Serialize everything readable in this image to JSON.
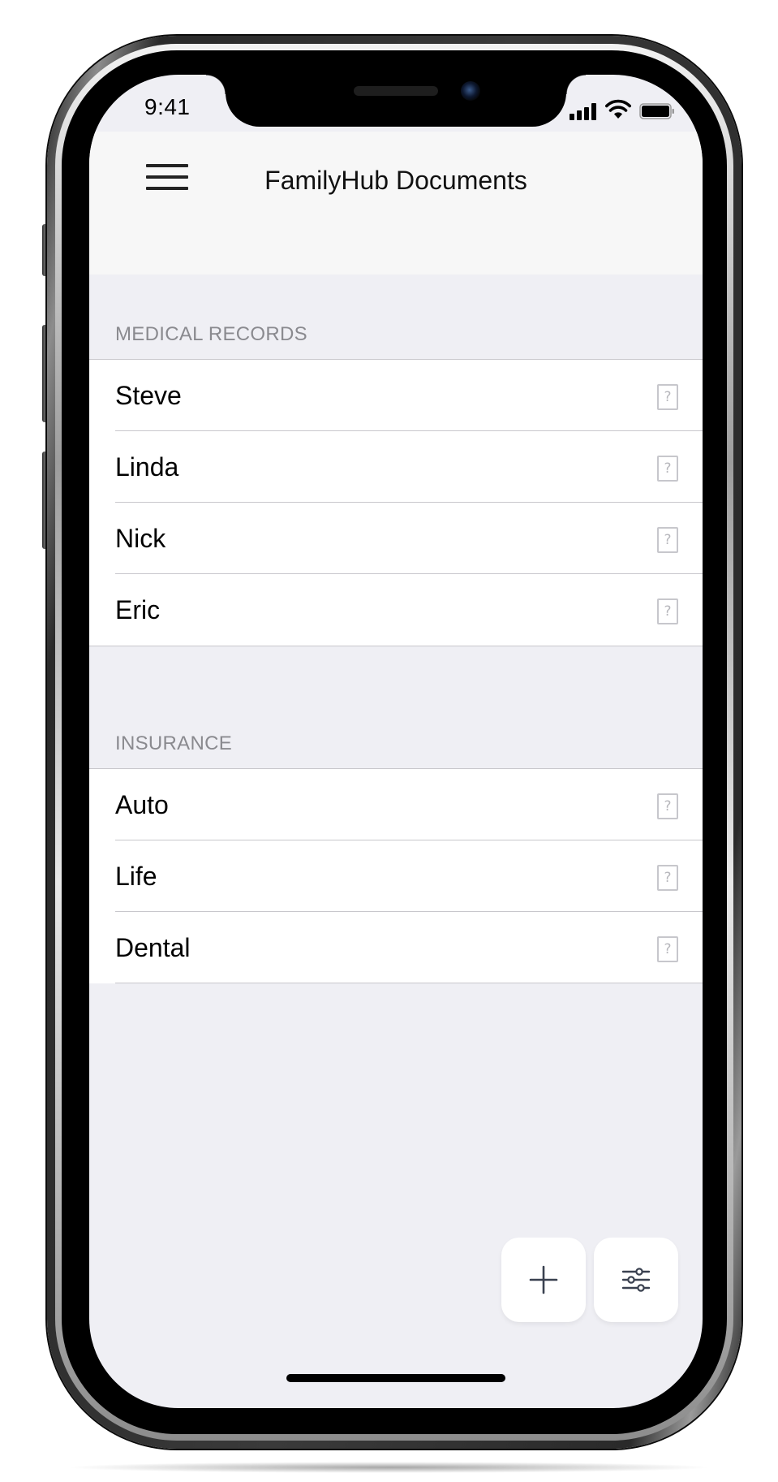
{
  "status_bar": {
    "time": "9:41"
  },
  "nav": {
    "title": "FamilyHub Documents",
    "menu_icon": "hamburger-menu-icon"
  },
  "sections": [
    {
      "header": "MEDICAL RECORDS",
      "items": [
        {
          "label": "Steve",
          "icon": "document-icon",
          "icon_glyph": "?"
        },
        {
          "label": "Linda",
          "icon": "document-icon",
          "icon_glyph": "?"
        },
        {
          "label": "Nick",
          "icon": "document-icon",
          "icon_glyph": "?"
        },
        {
          "label": "Eric",
          "icon": "document-icon",
          "icon_glyph": "?"
        }
      ]
    },
    {
      "header": "INSURANCE",
      "items": [
        {
          "label": "Auto",
          "icon": "document-icon",
          "icon_glyph": "?"
        },
        {
          "label": "Life",
          "icon": "document-icon",
          "icon_glyph": "?"
        },
        {
          "label": "Dental",
          "icon": "document-icon",
          "icon_glyph": "?"
        }
      ]
    }
  ],
  "actions": {
    "add_icon": "plus-icon",
    "filter_icon": "sliders-icon"
  },
  "colors": {
    "background": "#efeff4",
    "row_background": "#ffffff",
    "section_header_text": "#8a8a8f",
    "separator": "#c8c7cc",
    "icon_gray": "#c7c7cc",
    "fab_icon": "#3a4150"
  }
}
